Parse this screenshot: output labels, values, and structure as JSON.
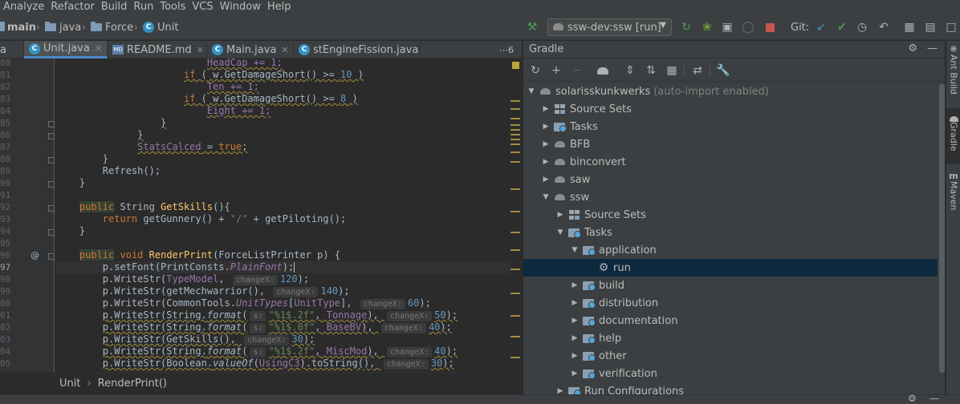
{
  "menu": [
    "Analyze",
    "Refactor",
    "Build",
    "Run",
    "Tools",
    "VCS",
    "Window",
    "Help"
  ],
  "breadcrumbs": {
    "module": "main",
    "folder": "java",
    "package": "Force",
    "class": "Unit"
  },
  "toolbar": {
    "run_config": "ssw-dev:ssw [run]",
    "git_label": "Git:",
    "colors": {
      "run": "#499c54",
      "debug": "#6e9e3a",
      "stop": "#c75450",
      "git_update": "#3592c4",
      "git_commit": "#499c54"
    }
  },
  "tabs": [
    {
      "label": "a",
      "icon": "none"
    },
    {
      "label": "Unit.java",
      "icon": "class-icon",
      "active": true
    },
    {
      "label": "README.md",
      "icon": "markdown-icon"
    },
    {
      "label": "Main.java",
      "icon": "class-icon"
    },
    {
      "label": "stEngineFission.java",
      "icon": "class-icon"
    }
  ],
  "tab_overflow": "⋯6",
  "editor": {
    "line_numbers": [
      "80",
      "81",
      "82",
      "83",
      "84",
      "85",
      "86",
      "87",
      "88",
      "89",
      "90",
      "91",
      "92",
      "93",
      "94",
      "95",
      "96",
      "97",
      "98",
      "99",
      "00",
      "01",
      "02",
      "03",
      "04",
      "05"
    ],
    "current_line_index": 17,
    "annotation_symbol": "@"
  },
  "editor_footer": {
    "class": "Unit",
    "method": "RenderPrint()"
  },
  "gradle": {
    "title": "Gradle",
    "root": "solarisskunkwerks",
    "root_note": "(auto-import enabled)",
    "nodes": [
      {
        "label": "Source Sets",
        "depth": 1,
        "icon": "srcset",
        "expanded": false
      },
      {
        "label": "Tasks",
        "depth": 1,
        "icon": "folder",
        "expanded": false
      },
      {
        "label": "BFB",
        "depth": 1,
        "icon": "elephant",
        "expanded": false
      },
      {
        "label": "binconvert",
        "depth": 1,
        "icon": "elephant",
        "expanded": false
      },
      {
        "label": "saw",
        "depth": 1,
        "icon": "elephant",
        "expanded": false
      },
      {
        "label": "ssw",
        "depth": 1,
        "icon": "elephant",
        "expanded": true
      },
      {
        "label": "Source Sets",
        "depth": 2,
        "icon": "srcset",
        "expanded": false
      },
      {
        "label": "Tasks",
        "depth": 2,
        "icon": "folder",
        "expanded": true
      },
      {
        "label": "application",
        "depth": 3,
        "icon": "folder",
        "expanded": true
      },
      {
        "label": "run",
        "depth": 4,
        "icon": "gear",
        "leaf": true,
        "selected": true
      },
      {
        "label": "build",
        "depth": 3,
        "icon": "folder",
        "expanded": false
      },
      {
        "label": "distribution",
        "depth": 3,
        "icon": "folder",
        "expanded": false
      },
      {
        "label": "documentation",
        "depth": 3,
        "icon": "folder",
        "expanded": false
      },
      {
        "label": "help",
        "depth": 3,
        "icon": "folder",
        "expanded": false
      },
      {
        "label": "other",
        "depth": 3,
        "icon": "folder",
        "expanded": false
      },
      {
        "label": "verification",
        "depth": 3,
        "icon": "folder",
        "expanded": false
      },
      {
        "label": "Run Configurations",
        "depth": 2,
        "icon": "folder",
        "expanded": false
      }
    ]
  },
  "right_strip": [
    "Ant Build",
    "Gradle",
    "Maven"
  ]
}
